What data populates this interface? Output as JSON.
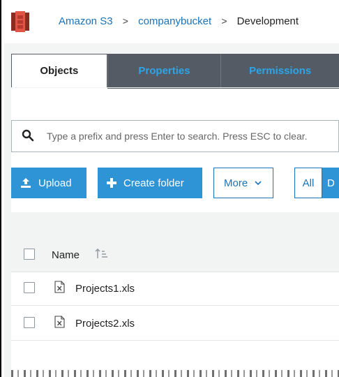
{
  "breadcrumb": {
    "items": [
      "Amazon S3",
      "companybucket",
      "Development"
    ],
    "separator": ">"
  },
  "tabs": [
    {
      "label": "Objects",
      "active": true
    },
    {
      "label": "Properties",
      "active": false
    },
    {
      "label": "Permissions",
      "active": false
    }
  ],
  "search": {
    "placeholder": "Type a prefix and press Enter to search. Press ESC to clear."
  },
  "toolbar": {
    "upload_label": "Upload",
    "create_folder_label": "Create folder",
    "more_label": "More",
    "all_label": "All",
    "d_label": "D"
  },
  "table": {
    "header": {
      "name": "Name"
    },
    "rows": [
      {
        "name": "Projects1.xls",
        "icon": "excel-file-icon"
      },
      {
        "name": "Projects2.xls",
        "icon": "excel-file-icon"
      }
    ]
  },
  "colors": {
    "accent": "#2f94d6",
    "link": "#1a73b8",
    "tab_dark": "#545b64",
    "logo": "#e25444"
  }
}
